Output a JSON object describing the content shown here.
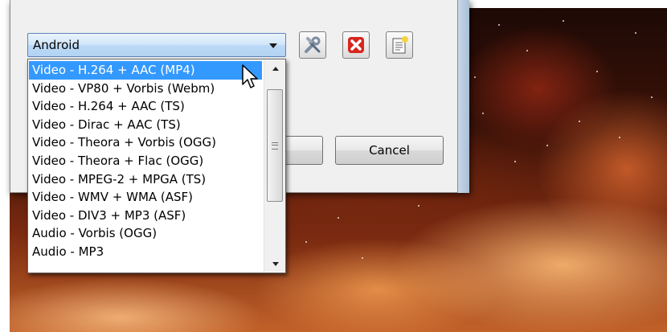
{
  "profile_combo": {
    "selected": "Android"
  },
  "toolbar": {
    "edit_icon": "wrench-screwdriver-icon",
    "delete_icon": "red-x-delete-icon",
    "new_icon": "new-document-icon"
  },
  "buttons": {
    "cancel": "Cancel"
  },
  "dropdown": {
    "items": [
      {
        "label": "Video - H.264 + AAC (MP4)",
        "selected": true
      },
      {
        "label": "Video - VP80 + Vorbis (Webm)",
        "selected": false
      },
      {
        "label": "Video - H.264 + AAC (TS)",
        "selected": false
      },
      {
        "label": "Video - Dirac + AAC (TS)",
        "selected": false
      },
      {
        "label": "Video - Theora + Vorbis (OGG)",
        "selected": false
      },
      {
        "label": "Video - Theora + Flac (OGG)",
        "selected": false
      },
      {
        "label": "Video - MPEG-2 + MPGA (TS)",
        "selected": false
      },
      {
        "label": "Video - WMV + WMA (ASF)",
        "selected": false
      },
      {
        "label": "Video - DIV3 + MP3 (ASF)",
        "selected": false
      },
      {
        "label": "Audio - Vorbis (OGG)",
        "selected": false
      },
      {
        "label": "Audio - MP3",
        "selected": false
      }
    ]
  },
  "colors": {
    "selection": "#3399ff",
    "combo_border": "#5c82b5"
  }
}
